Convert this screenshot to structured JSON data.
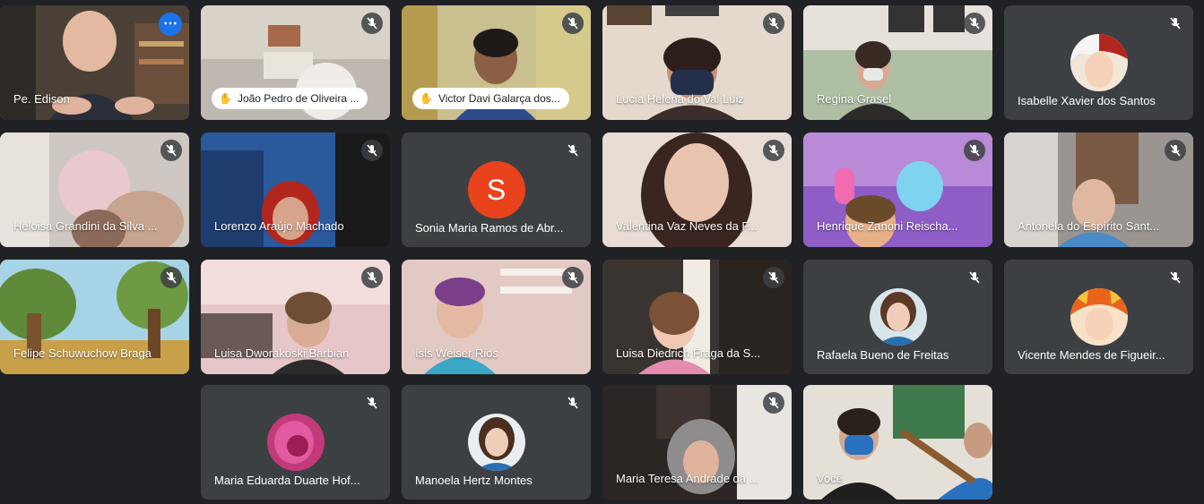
{
  "colors": {
    "background": "#202124",
    "tile": "#3c4043",
    "active_outline": "#8ab4f8",
    "more_button": "#1a73e8",
    "letter_avatar": "#e8431c"
  },
  "participants": [
    {
      "name": "Pe. Edison",
      "muted": false,
      "hand_raised": false,
      "active_speaker": true,
      "view": "video"
    },
    {
      "name": "João Pedro de Oliveira ...",
      "muted": true,
      "hand_raised": true,
      "view": "video"
    },
    {
      "name": "Victor Davi Galarça dos...",
      "muted": true,
      "hand_raised": true,
      "view": "video"
    },
    {
      "name": "Lucia Helena do Val Luiz",
      "muted": true,
      "hand_raised": false,
      "view": "video"
    },
    {
      "name": "Regina Grasel",
      "muted": true,
      "hand_raised": false,
      "view": "video"
    },
    {
      "name": "Isabelle Xavier dos Santos",
      "muted": true,
      "hand_raised": false,
      "view": "avatar"
    },
    {
      "name": "Heloisa Grandini da Silva ...",
      "muted": true,
      "hand_raised": false,
      "view": "video"
    },
    {
      "name": "Lorenzo Araújo Machado",
      "muted": true,
      "hand_raised": false,
      "view": "video"
    },
    {
      "name": "Sonia Maria Ramos de Abr...",
      "muted": true,
      "hand_raised": false,
      "view": "letter",
      "initial": "S"
    },
    {
      "name": "Valentina Vaz Neves da F...",
      "muted": true,
      "hand_raised": false,
      "view": "video"
    },
    {
      "name": "Henrique Zanoni Reischa...",
      "muted": true,
      "hand_raised": false,
      "view": "video"
    },
    {
      "name": "Antonela do Espírito Sant...",
      "muted": true,
      "hand_raised": false,
      "view": "video"
    },
    {
      "name": "Felipe Schuwuchow Braga",
      "muted": true,
      "hand_raised": false,
      "view": "video"
    },
    {
      "name": "Luisa Dworakoski Barbian",
      "muted": true,
      "hand_raised": false,
      "view": "video"
    },
    {
      "name": "ísis Weiser Rios",
      "muted": true,
      "hand_raised": false,
      "view": "video"
    },
    {
      "name": "Luisa Diedrich Fraga da S...",
      "muted": true,
      "hand_raised": false,
      "view": "video"
    },
    {
      "name": "Rafaela Bueno de Freitas",
      "muted": true,
      "hand_raised": false,
      "view": "avatar"
    },
    {
      "name": "Vicente Mendes de Figueir...",
      "muted": true,
      "hand_raised": false,
      "view": "avatar"
    },
    {
      "name": "Maria Eduarda Duarte Hof...",
      "muted": true,
      "hand_raised": false,
      "view": "avatar"
    },
    {
      "name": "Manoela Hertz Montes",
      "muted": true,
      "hand_raised": false,
      "view": "avatar"
    },
    {
      "name": "Maria Teresa Andrade da ...",
      "muted": true,
      "hand_raised": false,
      "view": "video"
    },
    {
      "name": "Você",
      "muted": false,
      "hand_raised": false,
      "view": "video"
    }
  ]
}
